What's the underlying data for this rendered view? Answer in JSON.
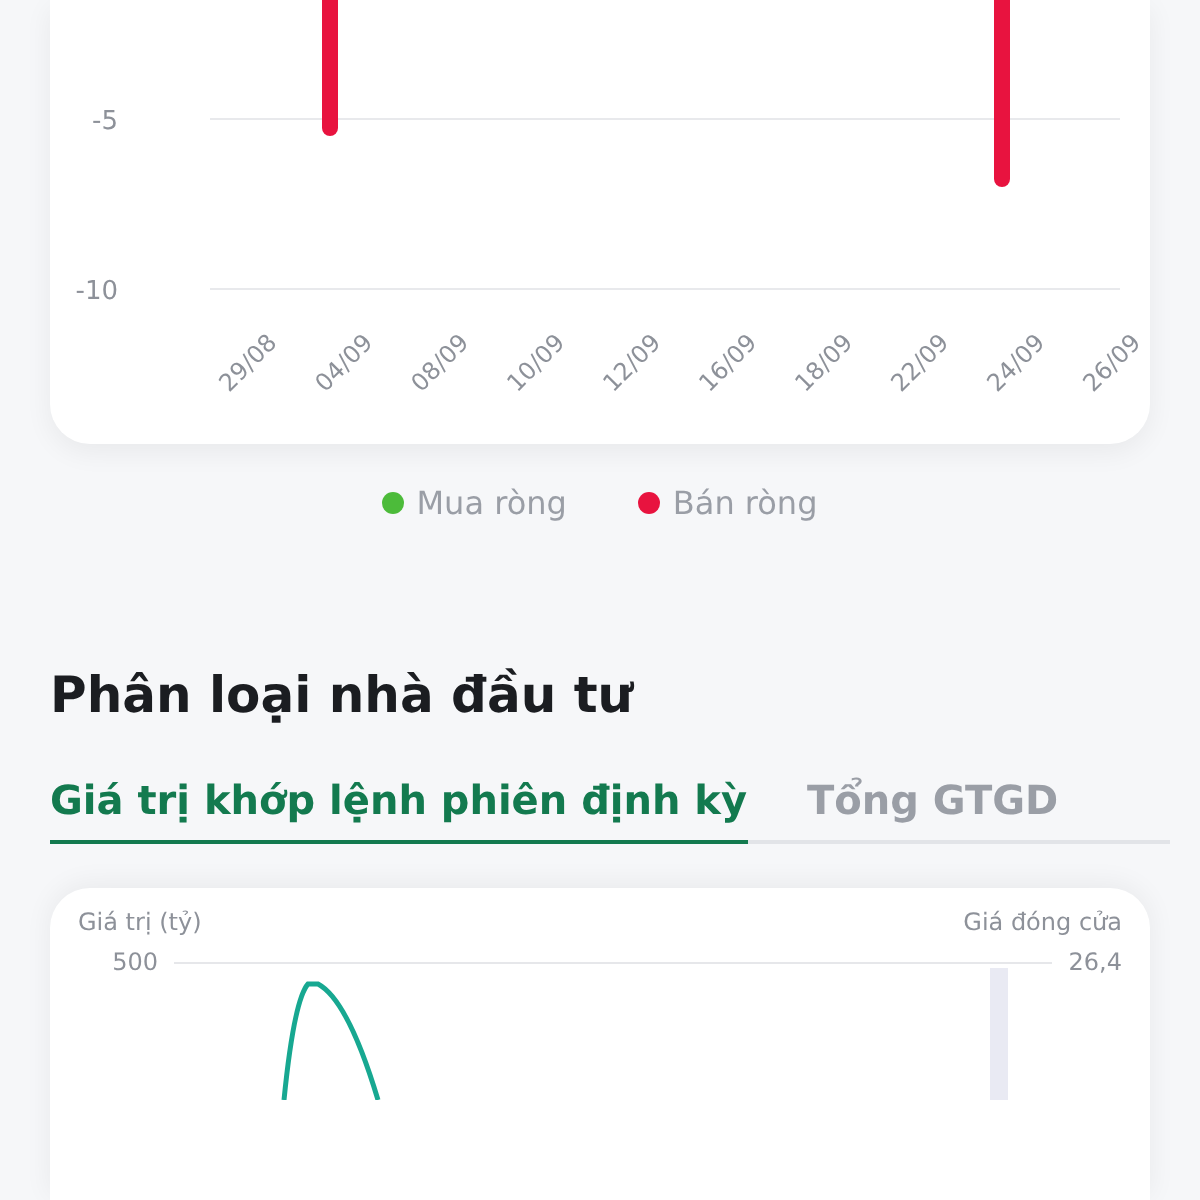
{
  "net_chart": {
    "chart_data": {
      "type": "bar",
      "categories": [
        "29/08",
        "04/09",
        "08/09",
        "10/09",
        "12/09",
        "16/09",
        "18/09",
        "22/09",
        "24/09",
        "26/09"
      ],
      "series": [
        {
          "name": "Mua ròng",
          "color": "#4cbb3a",
          "values": [
            null,
            null,
            null,
            null,
            null,
            null,
            null,
            null,
            null,
            null
          ]
        },
        {
          "name": "Bán ròng",
          "color": "#e8133f",
          "values": [
            null,
            -5.5,
            null,
            null,
            null,
            null,
            null,
            null,
            -7,
            null
          ]
        }
      ],
      "yticks": [
        -10,
        -5
      ],
      "ylim": [
        -10,
        -1.5
      ]
    }
  },
  "investor_section": {
    "title": "Phân loại nhà đầu tư",
    "tabs": [
      {
        "label": "Giá trị khớp lệnh phiên định kỳ",
        "selected": true
      },
      {
        "label": "Tổng GTGD",
        "selected": false
      }
    ],
    "value_chart": {
      "left_axis_title": "Giá trị (tỷ)",
      "right_axis_title": "Giá đóng cửa",
      "left_tick": "500",
      "right_tick": "26,4"
    }
  }
}
